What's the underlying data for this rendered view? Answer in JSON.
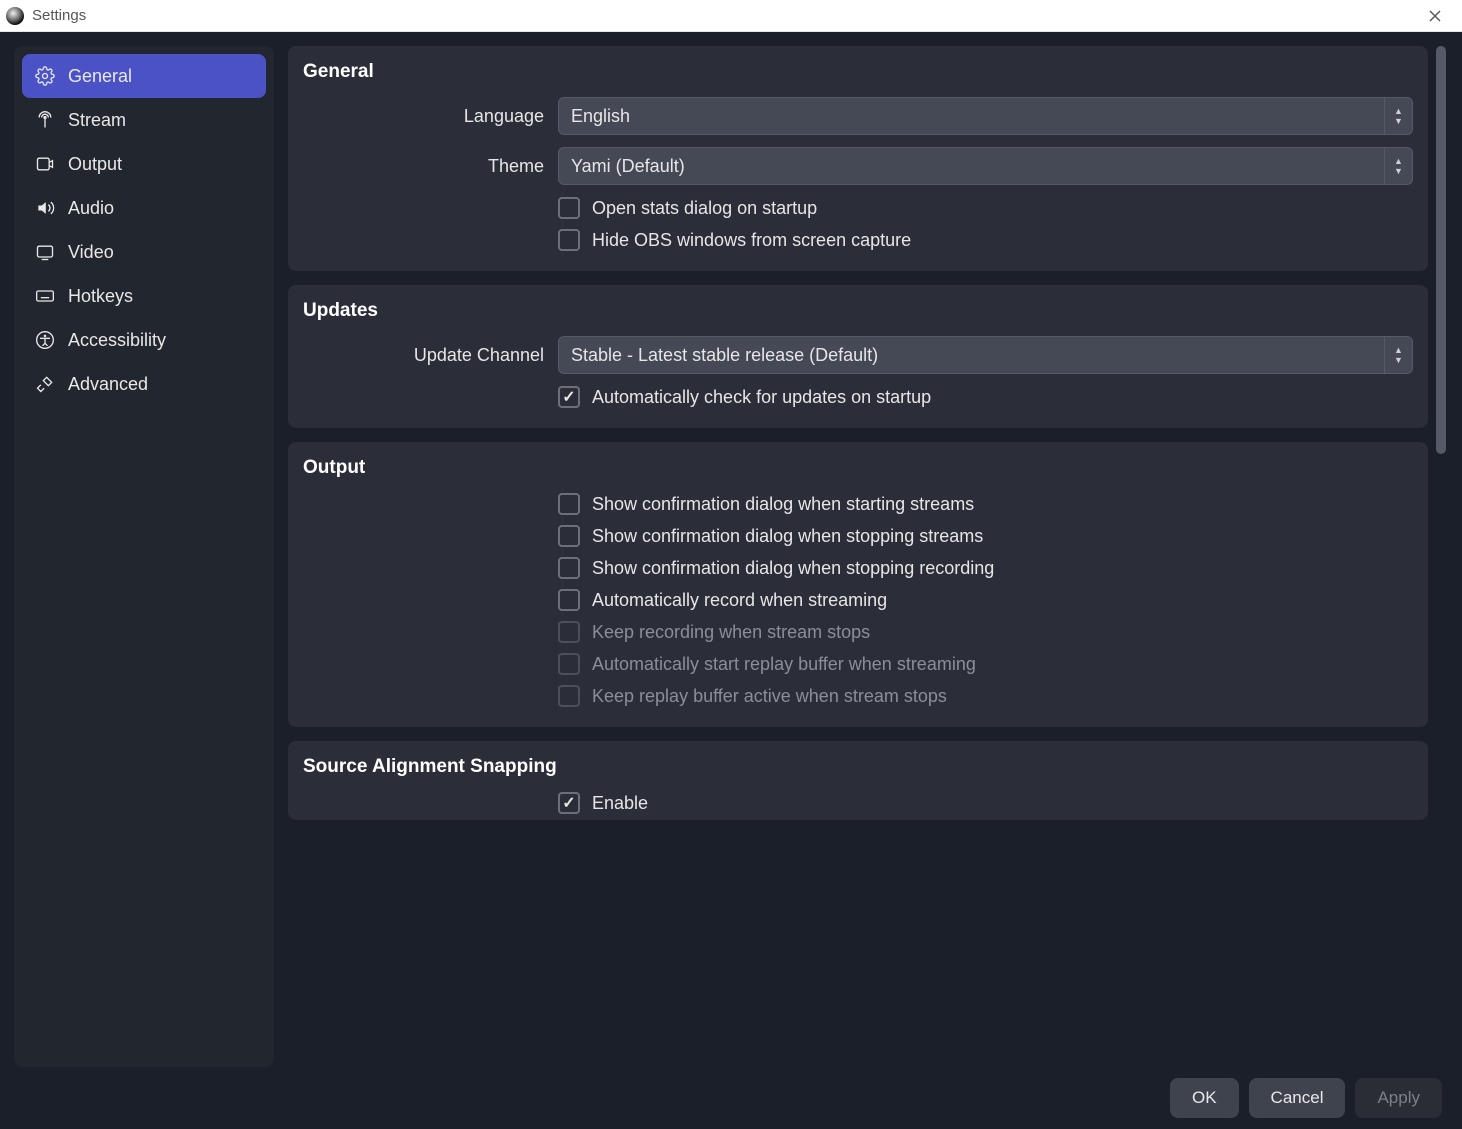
{
  "window": {
    "title": "Settings"
  },
  "sidebar": {
    "items": [
      {
        "label": "General"
      },
      {
        "label": "Stream"
      },
      {
        "label": "Output"
      },
      {
        "label": "Audio"
      },
      {
        "label": "Video"
      },
      {
        "label": "Hotkeys"
      },
      {
        "label": "Accessibility"
      },
      {
        "label": "Advanced"
      }
    ]
  },
  "sections": {
    "general": {
      "title": "General",
      "language_label": "Language",
      "language_value": "English",
      "theme_label": "Theme",
      "theme_value": "Yami (Default)",
      "open_stats": "Open stats dialog on startup",
      "hide_obs": "Hide OBS windows from screen capture"
    },
    "updates": {
      "title": "Updates",
      "channel_label": "Update Channel",
      "channel_value": "Stable - Latest stable release (Default)",
      "auto_check": "Automatically check for updates on startup"
    },
    "output": {
      "title": "Output",
      "confirm_start_stream": "Show confirmation dialog when starting streams",
      "confirm_stop_stream": "Show confirmation dialog when stopping streams",
      "confirm_stop_record": "Show confirmation dialog when stopping recording",
      "auto_record": "Automatically record when streaming",
      "keep_recording": "Keep recording when stream stops",
      "auto_replay": "Automatically start replay buffer when streaming",
      "keep_replay": "Keep replay buffer active when stream stops"
    },
    "snapping": {
      "title": "Source Alignment Snapping",
      "enable": "Enable"
    }
  },
  "footer": {
    "ok": "OK",
    "cancel": "Cancel",
    "apply": "Apply"
  }
}
